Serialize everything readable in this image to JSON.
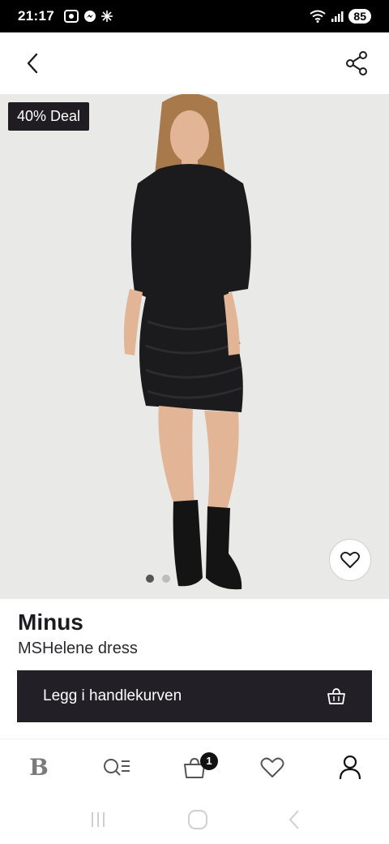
{
  "status_bar": {
    "time": "21:17",
    "battery": "85"
  },
  "product": {
    "deal_badge": "40% Deal",
    "brand": "Minus",
    "name": "MSHelene dress",
    "image_count": 2,
    "active_image": 1
  },
  "cart_button": {
    "label": "Legg i handlekurven"
  },
  "bottom_nav": {
    "logo": "B",
    "cart_count": "1",
    "items": [
      "home",
      "search",
      "cart",
      "wishlist",
      "profile"
    ]
  },
  "icons": {
    "back": "back-chevron-icon",
    "share": "share-icon",
    "favorite": "heart-icon",
    "bag": "shopping-bag-icon",
    "search": "search-list-icon",
    "profile": "user-icon"
  },
  "colors": {
    "primary": "#231f26",
    "badge_bg": "#1f1c22",
    "image_bg": "#e9e9e7"
  }
}
